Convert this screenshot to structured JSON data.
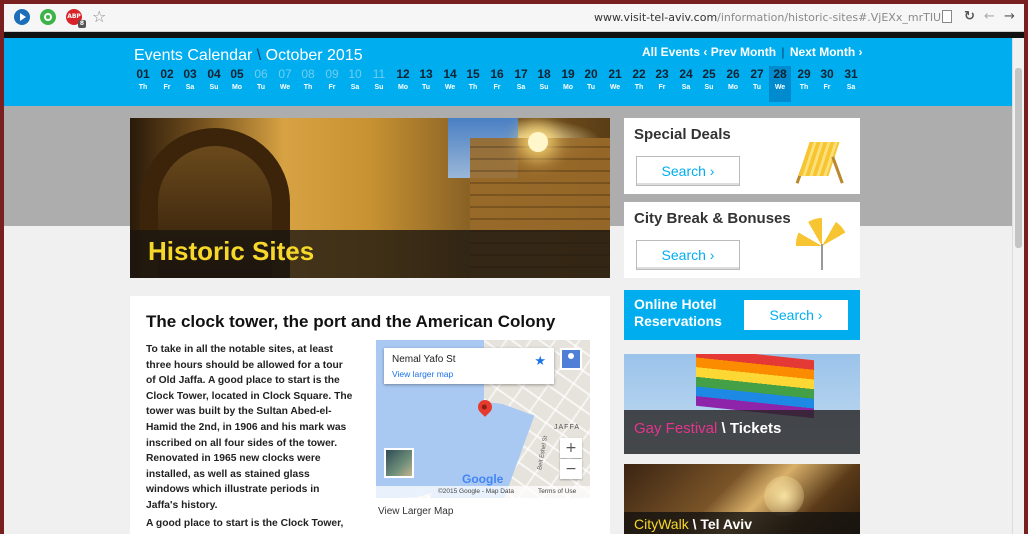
{
  "browser": {
    "url_host": "www.visit-tel-aviv.com",
    "url_path": "/information/historic-sites#.VjEXx_mrTIU",
    "adblock_badge": "ABP",
    "adblock_count": "8"
  },
  "calendar": {
    "title": "Events Calendar",
    "separator": "\\",
    "month": "October 2015",
    "nav": {
      "all_events": "All Events",
      "prev_month": "‹ Prev Month",
      "divider": "|",
      "next_month": "Next Month ›"
    },
    "selected_day": "28",
    "days": [
      {
        "num": "01",
        "wd": "Th",
        "past": false
      },
      {
        "num": "02",
        "wd": "Fr",
        "past": false
      },
      {
        "num": "03",
        "wd": "Sa",
        "past": false
      },
      {
        "num": "04",
        "wd": "Su",
        "past": false
      },
      {
        "num": "05",
        "wd": "Mo",
        "past": false
      },
      {
        "num": "06",
        "wd": "Tu",
        "past": true
      },
      {
        "num": "07",
        "wd": "We",
        "past": true
      },
      {
        "num": "08",
        "wd": "Th",
        "past": true
      },
      {
        "num": "09",
        "wd": "Fr",
        "past": true
      },
      {
        "num": "10",
        "wd": "Sa",
        "past": true
      },
      {
        "num": "11",
        "wd": "Su",
        "past": true
      },
      {
        "num": "12",
        "wd": "Mo",
        "past": false
      },
      {
        "num": "13",
        "wd": "Tu",
        "past": false
      },
      {
        "num": "14",
        "wd": "We",
        "past": false
      },
      {
        "num": "15",
        "wd": "Th",
        "past": false
      },
      {
        "num": "16",
        "wd": "Fr",
        "past": false
      },
      {
        "num": "17",
        "wd": "Sa",
        "past": false
      },
      {
        "num": "18",
        "wd": "Su",
        "past": false
      },
      {
        "num": "19",
        "wd": "Mo",
        "past": false
      },
      {
        "num": "20",
        "wd": "Tu",
        "past": false
      },
      {
        "num": "21",
        "wd": "We",
        "past": false
      },
      {
        "num": "22",
        "wd": "Th",
        "past": false
      },
      {
        "num": "23",
        "wd": "Fr",
        "past": false
      },
      {
        "num": "24",
        "wd": "Sa",
        "past": false
      },
      {
        "num": "25",
        "wd": "Su",
        "past": false
      },
      {
        "num": "26",
        "wd": "Mo",
        "past": false
      },
      {
        "num": "27",
        "wd": "Tu",
        "past": false
      },
      {
        "num": "28",
        "wd": "We",
        "past": false
      },
      {
        "num": "29",
        "wd": "Th",
        "past": false
      },
      {
        "num": "30",
        "wd": "Fr",
        "past": false
      },
      {
        "num": "31",
        "wd": "Sa",
        "past": false
      }
    ]
  },
  "hero": {
    "title": "Historic Sites"
  },
  "article": {
    "heading": "The clock tower, the port and the American Colony",
    "paragraph": "To take in all the notable sites, at least three hours should be allowed for a tour of Old Jaffa. A good place to start is the Clock Tower, located in Clock Square. The tower was built by the Sultan Abed-el-Hamid the 2nd, in 1906 and his mark was inscribed on all four sides of the tower. Renovated in 1965 new clocks were installed, as well as stained glass windows which illustrate periods in Jaffa's history.",
    "paragraph2": "A good place to start is the Clock Tower,"
  },
  "map": {
    "place": "Nemal Yafo St",
    "view_larger_link": "View larger map",
    "area_label": "JAFFA",
    "street_label": "Beit Eshel St",
    "zoom_in": "+",
    "zoom_out": "−",
    "logo": "Google",
    "copyright": "©2015 Google - Map Data",
    "terms": "Terms of Use",
    "view_larger_below": "View Larger Map"
  },
  "sidebar": {
    "special_deals": {
      "title": "Special Deals",
      "button": "Search ›"
    },
    "city_break": {
      "title": "City Break & Bonuses",
      "button": "Search ›"
    },
    "hotel": {
      "line1": "Online Hotel",
      "line2": "Reservations",
      "button": "Search ›"
    },
    "gay_festival": {
      "highlight": "Gay Festival",
      "sep": " \\ ",
      "rest": "Tickets"
    },
    "citywalk": {
      "highlight": "CityWalk",
      "sep": " \\ ",
      "rest": "Tel Aviv"
    }
  },
  "colors": {
    "accent": "#00aeef",
    "hero_title": "#f7d82a",
    "gay_pink": "#e6338e"
  }
}
